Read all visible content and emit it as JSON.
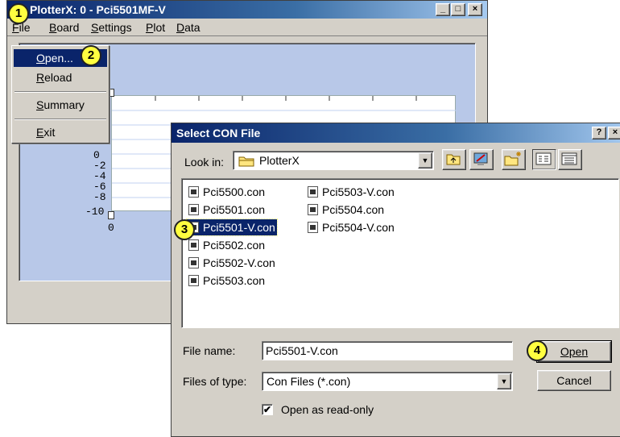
{
  "main_window": {
    "title": "PlotterX:  0 - Pci5501MF-V",
    "controls": {
      "minimize": "_",
      "maximize": "□",
      "close": "×"
    },
    "menu": [
      "File",
      "Board",
      "Settings",
      "Plot",
      "Data"
    ]
  },
  "plot": {
    "y_ticks": [
      "0",
      "-2",
      "-4",
      "-6",
      "-8",
      "-10"
    ],
    "y_top": "0",
    "x_start": "0",
    "colors": {
      "frame": "#b8c8e8",
      "grid": "#c0d0f0"
    }
  },
  "file_menu": {
    "items": [
      "Open...",
      "Reload",
      "Summary",
      "Exit"
    ],
    "highlighted": "Open..."
  },
  "dialog": {
    "title": "Select CON File",
    "help": "?",
    "close": "×",
    "look_in_label": "Look in:",
    "look_in_value": "PlotterX",
    "toolbar_icons": [
      "up-folder-icon",
      "desktop-icon",
      "new-folder-icon",
      "list-view-icon",
      "details-view-icon"
    ],
    "files_col1": [
      "Pci5500.con",
      "Pci5501.con",
      "Pci5501-V.con",
      "Pci5502.con",
      "Pci5502-V.con",
      "Pci5503.con"
    ],
    "files_col2": [
      "Pci5503-V.con",
      "Pci5504.con",
      "Pci5504-V.con"
    ],
    "selected_file": "Pci5501-V.con",
    "file_name_label": "File name:",
    "file_name_value": "Pci5501-V.con",
    "files_of_type_label": "Files of type:",
    "files_of_type_value": "Con Files (*.con)",
    "open_button": "Open",
    "cancel_button": "Cancel",
    "read_only_label": "Open as read-only",
    "read_only_checked": true
  },
  "callouts": [
    "1",
    "2",
    "3",
    "4"
  ],
  "colors": {
    "title_active": "#0a246a",
    "highlight": "#0a246a",
    "callout": "#ffff40",
    "window": "#d4d0c8"
  }
}
